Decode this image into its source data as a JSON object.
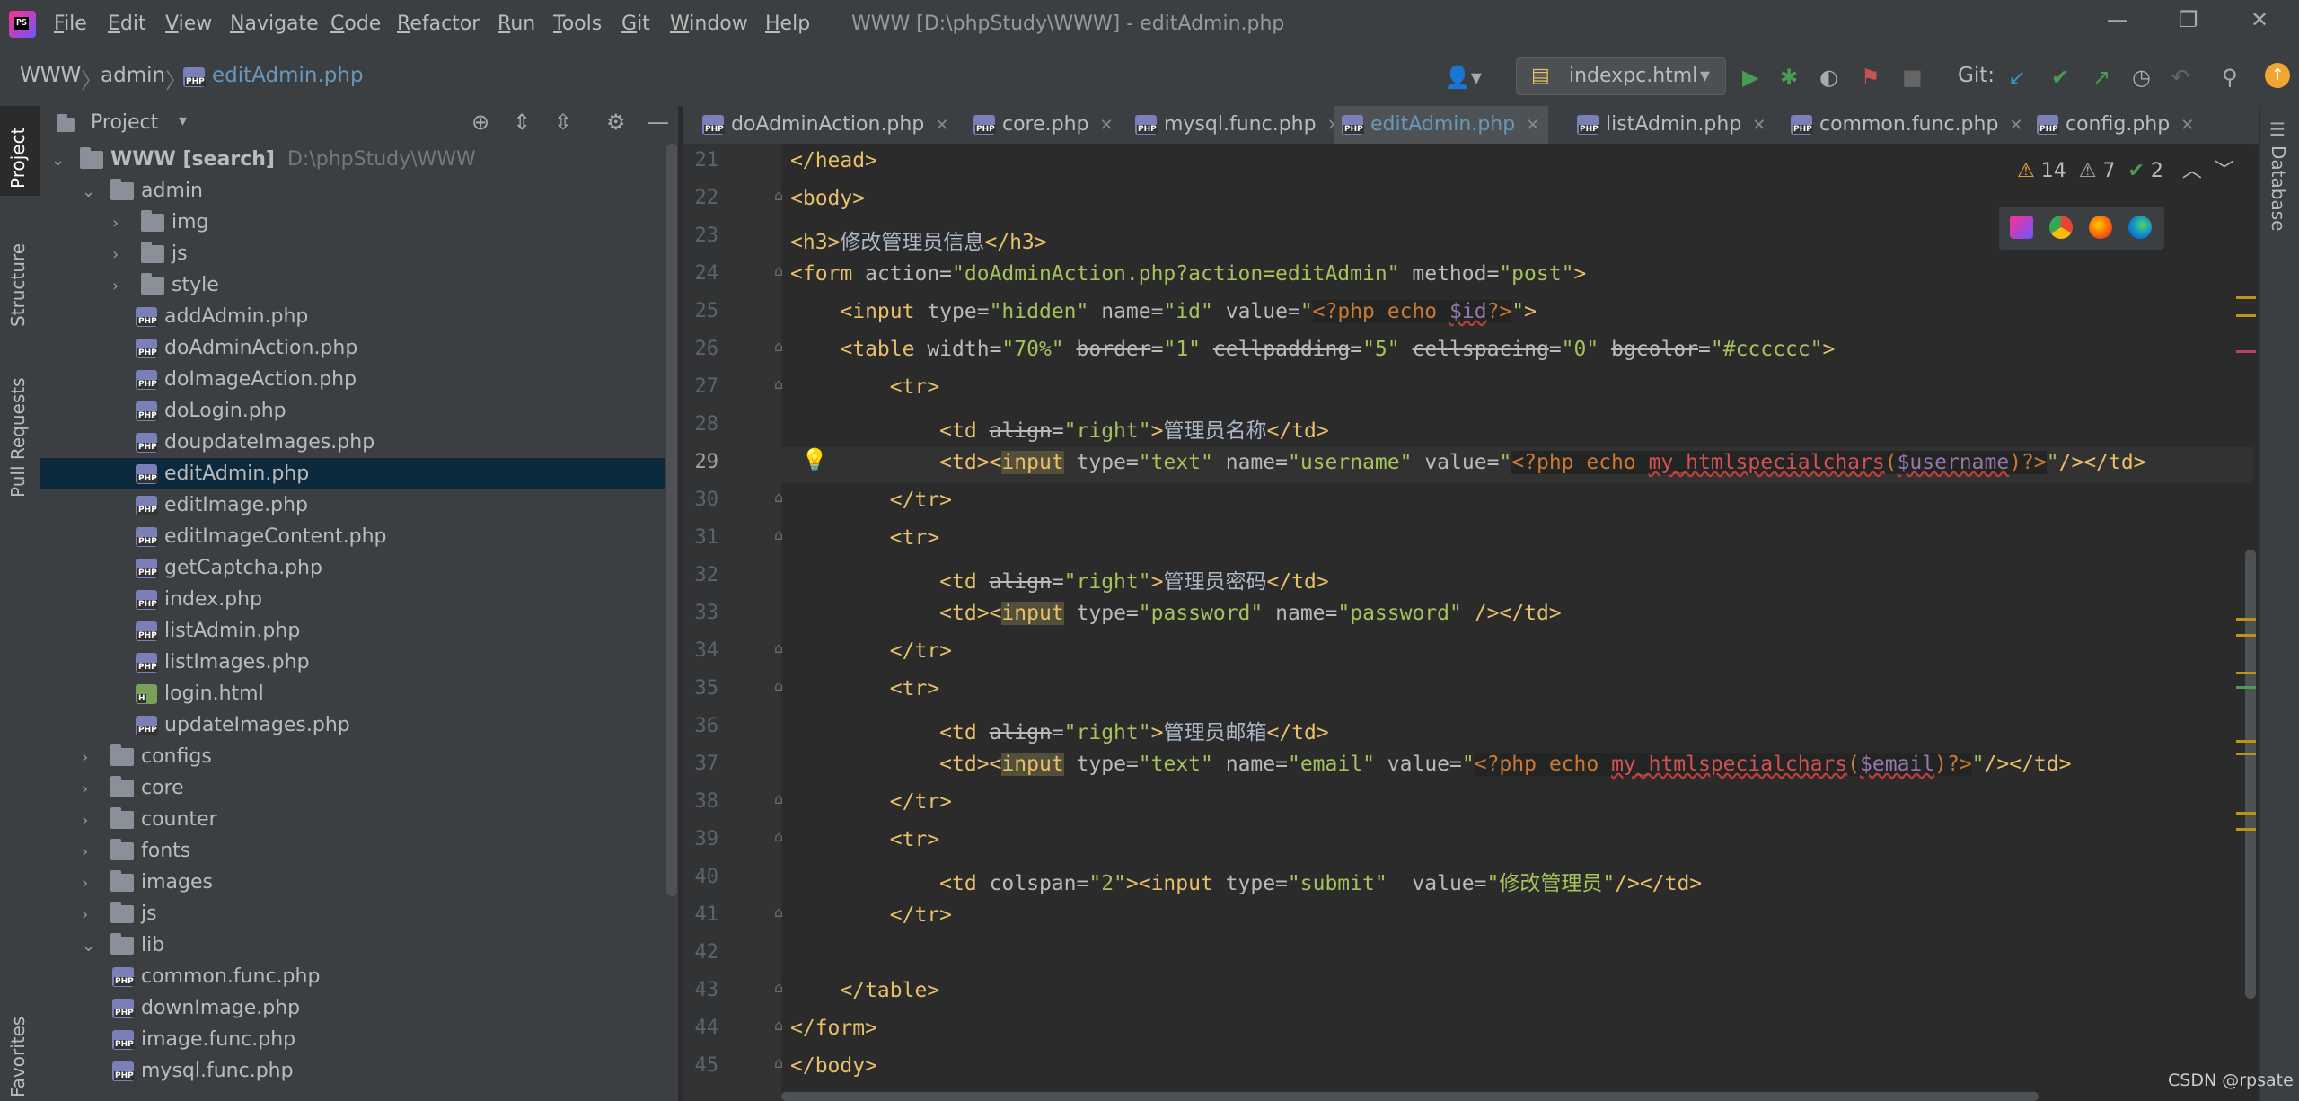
{
  "menu": {
    "items": [
      "File",
      "Edit",
      "View",
      "Navigate",
      "Code",
      "Refactor",
      "Run",
      "Tools",
      "Git",
      "Window",
      "Help"
    ],
    "window_title": "WWW [D:\\phpStudy\\WWW] - editAdmin.php"
  },
  "breadcrumb": {
    "root": "WWW",
    "folder": "admin",
    "file": "editAdmin.php"
  },
  "toolbar": {
    "run_config": "indexpc.html",
    "git_label": "Git:"
  },
  "left_strip": {
    "project": "Project",
    "structure": "Structure",
    "pull_requests": "Pull Requests",
    "favorites": "Favorites"
  },
  "right_strip": {
    "database": "Database"
  },
  "project_panel": {
    "title": "Project",
    "tree": [
      {
        "label": "WWW [search]",
        "hint": "D:\\phpStudy\\WWW",
        "type": "folder",
        "depth": 0,
        "expanded": true
      },
      {
        "label": "admin",
        "type": "folder",
        "depth": 1,
        "expanded": true
      },
      {
        "label": "img",
        "type": "folder",
        "depth": 2,
        "expanded": false
      },
      {
        "label": "js",
        "type": "folder",
        "depth": 2,
        "expanded": false
      },
      {
        "label": "style",
        "type": "folder",
        "depth": 2,
        "expanded": false
      },
      {
        "label": "addAdmin.php",
        "type": "php",
        "depth": 3
      },
      {
        "label": "doAdminAction.php",
        "type": "php",
        "depth": 3
      },
      {
        "label": "doImageAction.php",
        "type": "php",
        "depth": 3
      },
      {
        "label": "doLogin.php",
        "type": "php",
        "depth": 3
      },
      {
        "label": "doupdateImages.php",
        "type": "php",
        "depth": 3
      },
      {
        "label": "editAdmin.php",
        "type": "php",
        "depth": 3,
        "selected": true
      },
      {
        "label": "editImage.php",
        "type": "php",
        "depth": 3
      },
      {
        "label": "editImageContent.php",
        "type": "php",
        "depth": 3
      },
      {
        "label": "getCaptcha.php",
        "type": "php",
        "depth": 3
      },
      {
        "label": "index.php",
        "type": "php",
        "depth": 3
      },
      {
        "label": "listAdmin.php",
        "type": "php",
        "depth": 3
      },
      {
        "label": "listImages.php",
        "type": "php",
        "depth": 3
      },
      {
        "label": "login.html",
        "type": "html",
        "depth": 3
      },
      {
        "label": "updateImages.php",
        "type": "php",
        "depth": 3
      },
      {
        "label": "configs",
        "type": "folder",
        "depth": 1,
        "expanded": false
      },
      {
        "label": "core",
        "type": "folder",
        "depth": 1,
        "expanded": false
      },
      {
        "label": "counter",
        "type": "folder",
        "depth": 1,
        "expanded": false
      },
      {
        "label": "fonts",
        "type": "folder",
        "depth": 1,
        "expanded": false
      },
      {
        "label": "images",
        "type": "folder",
        "depth": 1,
        "expanded": false
      },
      {
        "label": "js",
        "type": "folder",
        "depth": 1,
        "expanded": false
      },
      {
        "label": "lib",
        "type": "folder",
        "depth": 1,
        "expanded": true
      },
      {
        "label": "common.func.php",
        "type": "php",
        "depth": 2
      },
      {
        "label": "downImage.php",
        "type": "php",
        "depth": 2
      },
      {
        "label": "image.func.php",
        "type": "php",
        "depth": 2
      },
      {
        "label": "mysql.func.php",
        "type": "php",
        "depth": 2
      }
    ]
  },
  "editor": {
    "tabs": [
      {
        "label": "doAdminAction.php"
      },
      {
        "label": "core.php"
      },
      {
        "label": "mysql.func.php"
      },
      {
        "label": "editAdmin.php",
        "active": true
      },
      {
        "label": "listAdmin.php"
      },
      {
        "label": "common.func.php"
      },
      {
        "label": "config.php"
      }
    ],
    "inspections": {
      "errors": "14",
      "warnings": "7",
      "ok": "2"
    },
    "current_line": 29,
    "lines": [
      {
        "n": "21",
        "html": "<span class=\"t\">&lt;/head&gt;</span>"
      },
      {
        "n": "22",
        "html": "<span class=\"t\">&lt;body&gt;</span>"
      },
      {
        "n": "23",
        "html": "<span class=\"t\">&lt;h3&gt;</span>修改管理员信息<span class=\"t\">&lt;/h3&gt;</span>"
      },
      {
        "n": "24",
        "html": "<span class=\"t\">&lt;form </span><span class=\"a\">action=</span><span class=\"s\">\"doAdminAction.php?action=editAdmin\"</span> <span class=\"a\">method=</span><span class=\"s\">\"post\"</span><span class=\"t\">&gt;</span>"
      },
      {
        "n": "25",
        "html": "    <span class=\"t\">&lt;input </span><span class=\"a\">type=</span><span class=\"s\">\"hidden\"</span> <span class=\"a\">name=</span><span class=\"s\">\"id\"</span> <span class=\"a\">value=</span><span class=\"s\">\"</span><span class=\"php-block\"><span class=\"k\">&lt;?php echo </span><span class=\"v bad\">$id</span><span class=\"k\">?&gt;</span></span><span class=\"s\">\"</span><span class=\"t\">&gt;</span>"
      },
      {
        "n": "26",
        "html": "    <span class=\"t\">&lt;table </span><span class=\"a\">width=</span><span class=\"s\">\"70%\"</span> <span class=\"a strike\">border</span><span class=\"a\">=</span><span class=\"s\">\"1\"</span> <span class=\"a strike\">cellpadding</span><span class=\"a\">=</span><span class=\"s\">\"5\"</span> <span class=\"a strike\">cellspacing</span><span class=\"a\">=</span><span class=\"s\">\"0\"</span> <span class=\"a strike\">bgcolor</span><span class=\"a\">=</span><span class=\"s\">\"#cccccc\"</span><span class=\"t\">&gt;</span>"
      },
      {
        "n": "27",
        "html": "        <span class=\"t\">&lt;tr&gt;</span>"
      },
      {
        "n": "28",
        "html": "            <span class=\"t\">&lt;td </span><span class=\"a strike\">align</span><span class=\"a\">=</span><span class=\"s\">\"right\"</span><span class=\"t\">&gt;</span>管理员名称<span class=\"t\">&lt;/td&gt;</span>"
      },
      {
        "n": "29",
        "html": "            <span class=\"t\">&lt;td&gt;&lt;</span><span class=\"t hl\">input</span> <span class=\"a\">type=</span><span class=\"s\">\"text\"</span> <span class=\"a\">name=</span><span class=\"s\">\"username\"</span> <span class=\"a\">value=</span><span class=\"s\">\"</span><span class=\"php-block\"><span class=\"k\">&lt;?php echo </span><span class=\"f bad\">my_htmlspecialchars</span><span class=\"k\">(</span><span class=\"v bad\">$username</span><span class=\"k\">)?&gt;</span></span><span class=\"s\">\"</span><span class=\"t\">/&gt;&lt;/td&gt;</span>"
      },
      {
        "n": "30",
        "html": "        <span class=\"t\">&lt;/tr&gt;</span>"
      },
      {
        "n": "31",
        "html": "        <span class=\"t\">&lt;tr&gt;</span>"
      },
      {
        "n": "32",
        "html": "            <span class=\"t\">&lt;td </span><span class=\"a strike\">align</span><span class=\"a\">=</span><span class=\"s\">\"right\"</span><span class=\"t\">&gt;</span>管理员密码<span class=\"t\">&lt;/td&gt;</span>"
      },
      {
        "n": "33",
        "html": "            <span class=\"t\">&lt;td&gt;&lt;</span><span class=\"t hl\">input</span> <span class=\"a\">type=</span><span class=\"s\">\"password\"</span> <span class=\"a\">name=</span><span class=\"s\">\"password\"</span> <span class=\"t\">/&gt;&lt;/td&gt;</span>"
      },
      {
        "n": "34",
        "html": "        <span class=\"t\">&lt;/tr&gt;</span>"
      },
      {
        "n": "35",
        "html": "        <span class=\"t\">&lt;tr&gt;</span>"
      },
      {
        "n": "36",
        "html": "            <span class=\"t\">&lt;td </span><span class=\"a strike\">align</span><span class=\"a\">=</span><span class=\"s\">\"right\"</span><span class=\"t\">&gt;</span>管理员邮箱<span class=\"t\">&lt;/td&gt;</span>"
      },
      {
        "n": "37",
        "html": "            <span class=\"t\">&lt;td&gt;&lt;</span><span class=\"t hl\">input</span> <span class=\"a\">type=</span><span class=\"s\">\"text\"</span> <span class=\"a\">name=</span><span class=\"s\">\"email\"</span> <span class=\"a\">value=</span><span class=\"s\">\"</span><span class=\"php-block\"><span class=\"k\">&lt;?php echo </span><span class=\"f bad\">my_htmlspecialchars</span><span class=\"k\">(</span><span class=\"v bad\">$email</span><span class=\"k\">)?&gt;</span></span><span class=\"s\">\"</span><span class=\"t\">/&gt;&lt;/td&gt;</span>"
      },
      {
        "n": "38",
        "html": "        <span class=\"t\">&lt;/tr&gt;</span>"
      },
      {
        "n": "39",
        "html": "        <span class=\"t\">&lt;tr&gt;</span>"
      },
      {
        "n": "40",
        "html": "            <span class=\"t\">&lt;td </span><span class=\"a\">colspan=</span><span class=\"s\">\"2\"</span><span class=\"t\">&gt;&lt;input </span><span class=\"a\">type=</span><span class=\"s\">\"submit\"</span>  <span class=\"a\">value=</span><span class=\"s\">\"修改管理员\"</span><span class=\"t\">/&gt;&lt;/td&gt;</span>"
      },
      {
        "n": "41",
        "html": "        <span class=\"t\">&lt;/tr&gt;</span>"
      },
      {
        "n": "42",
        "html": ""
      },
      {
        "n": "43",
        "html": "    <span class=\"t\">&lt;/table&gt;</span>"
      },
      {
        "n": "44",
        "html": "<span class=\"t\">&lt;/form&gt;</span>"
      },
      {
        "n": "45",
        "html": "<span class=\"t\">&lt;/body&gt;</span>"
      }
    ]
  },
  "watermark": "CSDN @rpsate"
}
